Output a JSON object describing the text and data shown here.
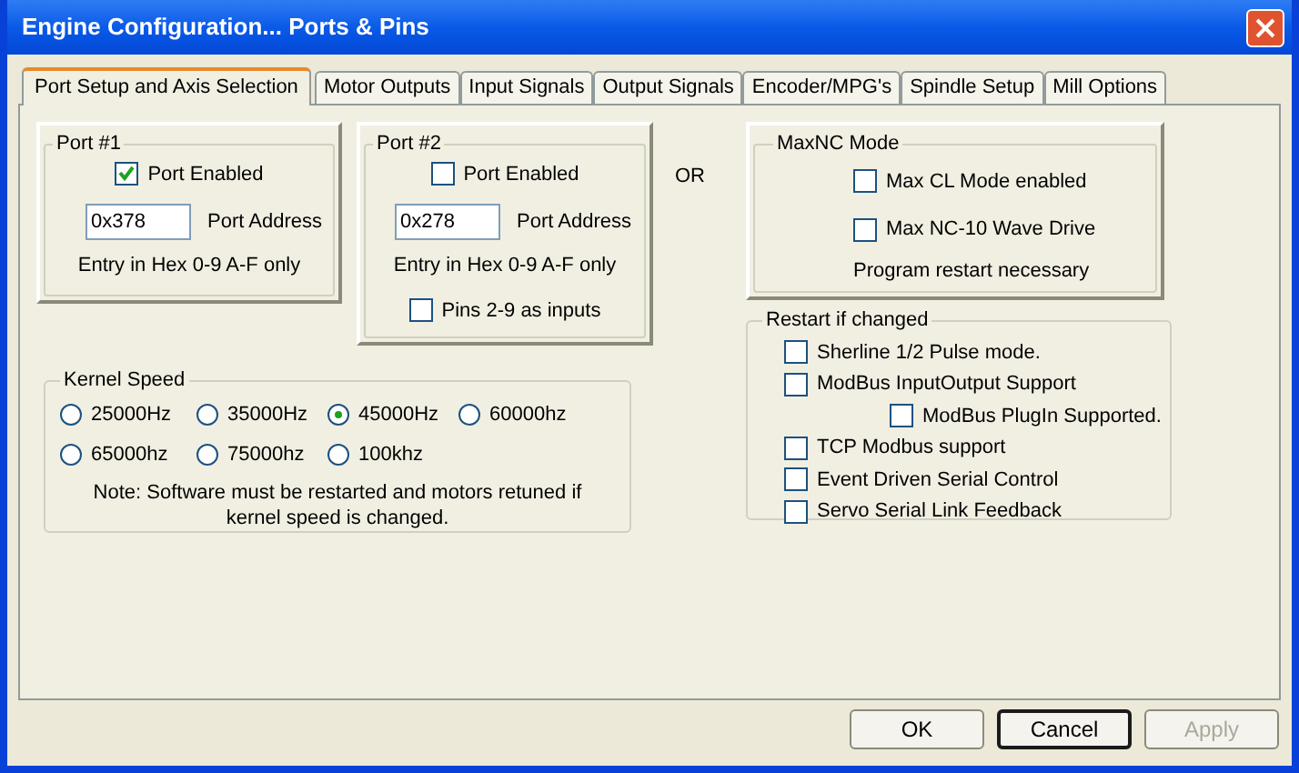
{
  "window": {
    "title": "Engine Configuration... Ports & Pins"
  },
  "tabs": [
    {
      "label": "Port Setup and Axis Selection",
      "selected": true
    },
    {
      "label": "Motor Outputs",
      "selected": false
    },
    {
      "label": "Input Signals",
      "selected": false
    },
    {
      "label": "Output Signals",
      "selected": false
    },
    {
      "label": "Encoder/MPG's",
      "selected": false
    },
    {
      "label": "Spindle Setup",
      "selected": false
    },
    {
      "label": "Mill Options",
      "selected": false
    }
  ],
  "port_1": {
    "legend": "Port #1",
    "enabled": {
      "label": "Port Enabled",
      "checked": true
    },
    "address": "0x378",
    "address_label": "Port Address",
    "hint": "Entry in Hex 0-9 A-F only"
  },
  "port_2": {
    "legend": "Port #2",
    "enabled": {
      "label": "Port Enabled",
      "checked": false
    },
    "address": "0x278",
    "address_label": "Port Address",
    "hint": "Entry in Hex 0-9 A-F only",
    "pins_inputs": {
      "label": "Pins 2-9 as inputs",
      "checked": false
    }
  },
  "or_label": "OR",
  "maxnc": {
    "legend": "MaxNC Mode",
    "options": [
      {
        "label": "Max CL Mode enabled",
        "checked": false
      },
      {
        "label": "Max NC-10 Wave Drive",
        "checked": false
      }
    ],
    "note": "Program restart necessary"
  },
  "restart": {
    "legend": "Restart if changed",
    "options": [
      {
        "label": "Sherline 1/2 Pulse mode.",
        "checked": false
      },
      {
        "label": "ModBus InputOutput Support",
        "checked": false,
        "children": [
          {
            "label": "ModBus PlugIn Supported.",
            "checked": false
          }
        ]
      },
      {
        "label": "TCP Modbus support",
        "checked": false
      },
      {
        "label": "Event Driven Serial Control",
        "checked": false
      },
      {
        "label": "Servo Serial Link Feedback",
        "checked": false
      }
    ]
  },
  "kernel_speed": {
    "legend": "Kernel Speed",
    "options": [
      {
        "label": "25000Hz",
        "selected": false
      },
      {
        "label": "35000Hz",
        "selected": false
      },
      {
        "label": "45000Hz",
        "selected": true
      },
      {
        "label": "60000hz",
        "selected": false
      },
      {
        "label": "65000hz",
        "selected": false
      },
      {
        "label": "75000hz",
        "selected": false
      },
      {
        "label": "100khz",
        "selected": false
      }
    ],
    "note": "Note: Software must be restarted and motors retuned if kernel speed is changed."
  },
  "buttons": [
    {
      "label": "OK",
      "kind": "normal",
      "disabled": false
    },
    {
      "label": "Cancel",
      "kind": "default",
      "disabled": false
    },
    {
      "label": "Apply",
      "kind": "normal",
      "disabled": true
    }
  ]
}
